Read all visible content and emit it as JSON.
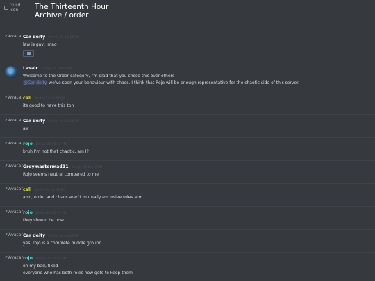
{
  "header": {
    "guild_icon_alt": "Guild icon",
    "guild_name": "The Thirteenth Hour",
    "channel_path": "Archive / order"
  },
  "avatar_alt": "Avatar",
  "messages": [
    {
      "author": "Car deity",
      "color": "#ffffff",
      "timestamp": "20-Apr-20 10:44 PM",
      "lines": [
        "law is gay, lmao"
      ],
      "has_attachment": true
    },
    {
      "author": "Lasair",
      "color": "#ffffff",
      "timestamp": "20-Apr-20 10:44 PM",
      "lines": [
        "Welcome to the Order category, I'm glad that you chose this over others"
      ],
      "mention": "@Car deity",
      "line2_rest": " we've seen your behaviour with chaos. I think that Rojo will be enough representative for the chaotic side of this server."
    },
    {
      "author": "call",
      "color": "#dfe03c",
      "timestamp": "20-Apr-20 10:44 PM",
      "lines": [
        "its good to have this tbh"
      ]
    },
    {
      "author": "Car deity",
      "color": "#ffffff",
      "timestamp": "20-Apr-20 10:44 PM",
      "lines": [
        "aw"
      ]
    },
    {
      "author": "rojo",
      "color": "#4fd2c4",
      "timestamp": "20-Apr-20 10:47 PM",
      "lines": [
        "bruh I'm not that chaotic, am I?"
      ]
    },
    {
      "author": "Greymastermad11",
      "color": "#ffffff",
      "timestamp": "20-Apr-20 10:47 PM",
      "lines": [
        "Rojo seems neutral compared to me"
      ]
    },
    {
      "author": "call",
      "color": "#dfe03c",
      "timestamp": "20-Apr-20 10:47 PM",
      "lines": [
        "also, order and chaos aren't mutually exclusive roles atm"
      ]
    },
    {
      "author": "rojo",
      "color": "#4fd2c4",
      "timestamp": "20-Apr-20 10:47 PM",
      "lines": [
        "they should be now"
      ]
    },
    {
      "author": "Car deity",
      "color": "#ffffff",
      "timestamp": "20-Apr-20 10:47 PM",
      "lines": [
        "yes, rojo is a complete middle ground"
      ]
    },
    {
      "author": "rojo",
      "color": "#4fd2c4",
      "timestamp": "20-Apr-20 10:48 PM",
      "lines": [
        "oh my bad, fixed",
        "everyone who has both roles now gets to keep them"
      ]
    }
  ]
}
